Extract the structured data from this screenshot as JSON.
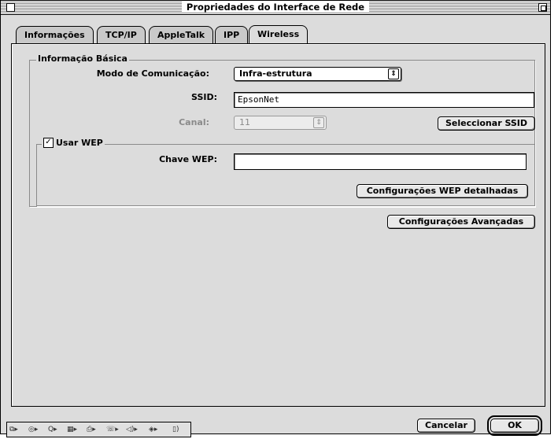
{
  "window": {
    "title": "Propriedades do Interface de Rede"
  },
  "tabs": [
    {
      "label": "Informações",
      "active": false
    },
    {
      "label": "TCP/IP",
      "active": false
    },
    {
      "label": "AppleTalk",
      "active": false
    },
    {
      "label": "IPP",
      "active": false
    },
    {
      "label": "Wireless",
      "active": true
    }
  ],
  "basic_info": {
    "group_label": "Informação Básica",
    "mode_label": "Modo de Comunicação:",
    "mode_value": "Infra-estrutura",
    "ssid_label": "SSID:",
    "ssid_value": "EpsonNet",
    "channel_label": "Canal:",
    "channel_value": "11",
    "select_ssid_button": "Seleccionar SSID"
  },
  "wep": {
    "checkbox_label": "Usar WEP",
    "checked": true,
    "key_label": "Chave WEP:",
    "key_value": "",
    "detailed_button": "Configurações WEP detalhadas"
  },
  "advanced_button": "Configurações Avançadas",
  "footer": {
    "cancel_button": "Cancelar",
    "ok_button": "OK"
  },
  "control_strip": {
    "icons": [
      "appletalk-icon",
      "cd-icon",
      "quicktime-icon",
      "monitor-icon",
      "printer-icon",
      "remote-access-icon",
      "sound-icon",
      "file-sharing-icon"
    ]
  }
}
